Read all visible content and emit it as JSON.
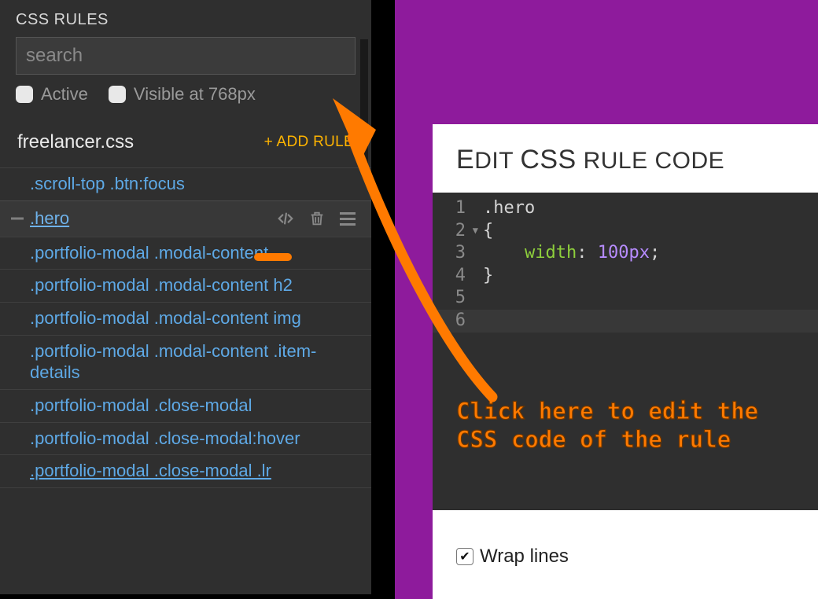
{
  "panel": {
    "title": "CSS RULES",
    "search_placeholder": "search",
    "filter_active": "Active",
    "filter_visible": "Visible at 768px",
    "file_name": "freelancer.css",
    "add_rule": "+ ADD RULE"
  },
  "rules": [
    ".scroll-top .btn:focus",
    ".hero",
    ".portfolio-modal .modal-content",
    ".portfolio-modal .modal-content h2",
    ".portfolio-modal .modal-content img",
    ".portfolio-modal .modal-content .item-details",
    ".portfolio-modal .close-modal",
    ".portfolio-modal .close-modal:hover",
    ".portfolio-modal .close-modal .lr"
  ],
  "selected_rule_index": 1,
  "editor": {
    "title_prefix": "E",
    "title_mid": "DIT",
    "title_css": "CSS",
    "title_rest": " RULE CODE",
    "lines": {
      "l1": ".hero",
      "l2": "{",
      "l3_prop": "width",
      "l3_val": "100px",
      "l4": "}"
    },
    "wrap_label": "Wrap lines",
    "wrap_checked": true
  },
  "callout": {
    "line1": "Click here to edit the",
    "line2": "CSS code of the rule"
  }
}
